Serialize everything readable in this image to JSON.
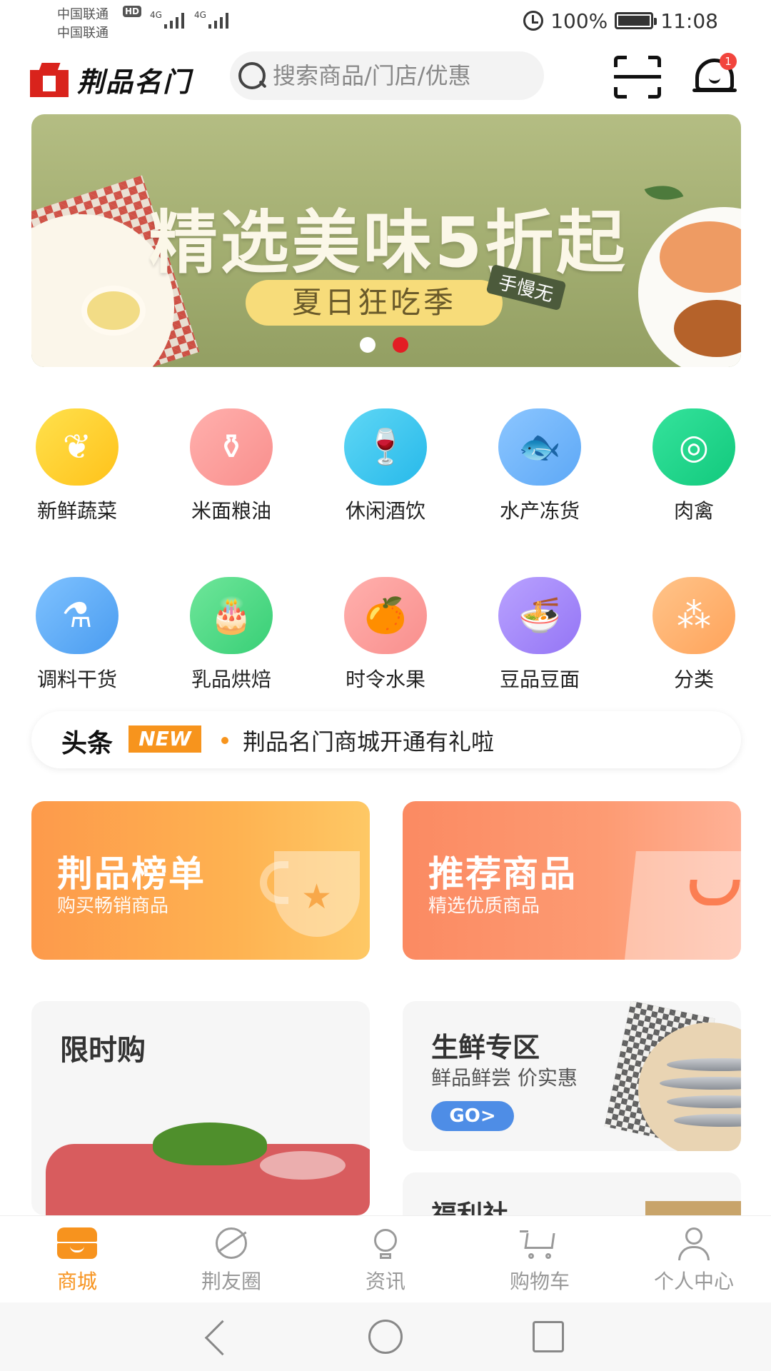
{
  "status_bar": {
    "carrier1": "中国联通",
    "carrier2": "中国联通",
    "hd": "HD",
    "net1": "4G",
    "net2": "4G",
    "battery": "100%",
    "time": "11:08"
  },
  "header": {
    "logo_text": "荆品名门",
    "search_placeholder": "搜索商品/门店/优惠",
    "notification_count": "1"
  },
  "banner": {
    "title": "精选美味5折起",
    "subtitle": "夏日狂吃季",
    "tag": "手慢无",
    "page_count": 2,
    "active_page": 2
  },
  "categories": [
    {
      "label": "新鲜蔬菜",
      "icon": "vegetable-icon",
      "color_from": "#ffe14d",
      "color_to": "#ffc21a",
      "glyph": "❦"
    },
    {
      "label": "米面粮油",
      "icon": "oil-bottle-icon",
      "color_from": "#ffb0ad",
      "color_to": "#f98f8d",
      "glyph": "⚱"
    },
    {
      "label": "休闲酒饮",
      "icon": "wine-icon",
      "color_from": "#5fd7f5",
      "color_to": "#27b9ea",
      "glyph": "🍷"
    },
    {
      "label": "水产冻货",
      "icon": "fish-icon",
      "color_from": "#8cc6ff",
      "color_to": "#5da8f6",
      "glyph": "🐟"
    },
    {
      "label": "肉禽",
      "icon": "meat-icon",
      "color_from": "#35e39c",
      "color_to": "#12c97d",
      "glyph": "◎"
    },
    {
      "label": "调料干货",
      "icon": "seasoning-icon",
      "color_from": "#7fc2ff",
      "color_to": "#4a9cf0",
      "glyph": "⚗"
    },
    {
      "label": "乳品烘焙",
      "icon": "cake-icon",
      "color_from": "#6fe69a",
      "color_to": "#38cf76",
      "glyph": "🎂"
    },
    {
      "label": "时令水果",
      "icon": "fruit-icon",
      "color_from": "#ffb0ad",
      "color_to": "#f98f8d",
      "glyph": "🍊"
    },
    {
      "label": "豆品豆面",
      "icon": "noodle-bowl-icon",
      "color_from": "#b9a2ff",
      "color_to": "#9475f5",
      "glyph": "🍜"
    },
    {
      "label": "分类",
      "icon": "category-icon",
      "color_from": "#ffc48a",
      "color_to": "#ffa35a",
      "glyph": "⁂"
    }
  ],
  "headline": {
    "title": "头条",
    "badge": "NEW",
    "text": "荆品名门商城开通有礼啦"
  },
  "promos": {
    "ranking": {
      "title": "荆品榜单",
      "subtitle": "购买畅销商品"
    },
    "recommend": {
      "title": "推荐商品",
      "subtitle": "精选优质商品"
    }
  },
  "features": {
    "flash_sale": {
      "title": "限时购"
    },
    "fresh": {
      "title": "生鲜专区",
      "subtitle": "鲜品鲜尝 价实惠",
      "button": "GO>"
    },
    "welfare": {
      "title": "福利社"
    }
  },
  "bottom_nav": [
    {
      "label": "商城",
      "active": true
    },
    {
      "label": "荆友圈",
      "active": false
    },
    {
      "label": "资讯",
      "active": false
    },
    {
      "label": "购物车",
      "active": false
    },
    {
      "label": "个人中心",
      "active": false
    }
  ],
  "colors": {
    "accent": "#f7931e",
    "badge_red": "#f2453d",
    "go_blue": "#4e8de6"
  }
}
